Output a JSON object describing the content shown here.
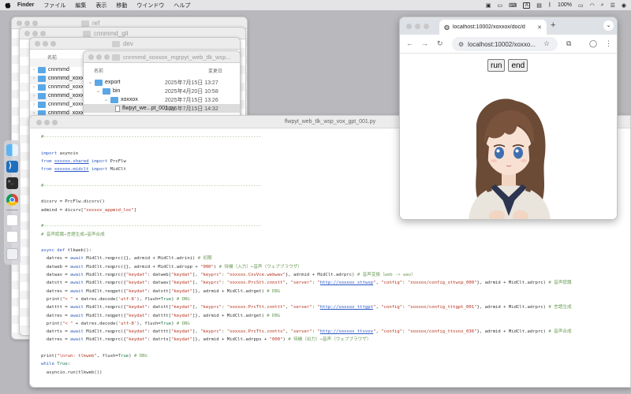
{
  "menubar": {
    "app_name": "Finder",
    "items": [
      "ファイル",
      "編集",
      "表示",
      "移動",
      "ウインドウ",
      "ヘルプ"
    ],
    "input_badge": "A",
    "battery": "100%"
  },
  "finder_windows": {
    "ref": "ref",
    "git": "cnnmmd_git",
    "dev": "dev",
    "col_name": "名前",
    "sidebar_rows": [
      "cnnmmd",
      "cnnmmd_xoxx",
      "cnnmmd_xoxx",
      "cnnmmd_xoxx",
      "cnnmmd_xoxx",
      "cnnmmd_xoxx"
    ]
  },
  "finder_front": {
    "title": "cnnmmd_xoxxox_mgrpyt_web_tlk_wsp...",
    "col_name": "名前",
    "col_date": "変更日",
    "rows": [
      {
        "name": "export",
        "date": "2025年7月15日 13:27"
      },
      {
        "name": "bin",
        "date": "2025年4月20日 10:58"
      },
      {
        "name": "xoxxox",
        "date": "2025年7月15日 13:26"
      },
      {
        "name": "flwpyt_we...pt_001.py",
        "date": "2025年7月15日 14:32"
      }
    ]
  },
  "editor": {
    "title": "flwpyt_web_tlk_wsp_vox_gpt_001.py"
  },
  "browser": {
    "tab_title": "localhost:10002/xoxxox/doc/d",
    "url": "localhost:10002/xoxxo...",
    "run_label": "run",
    "end_label": "end"
  },
  "colors": {
    "comment": "#6a9955",
    "keyword": "#2f5fbf",
    "string": "#b5321d",
    "link": "#2a56c6",
    "number": "#1c7a4a"
  }
}
